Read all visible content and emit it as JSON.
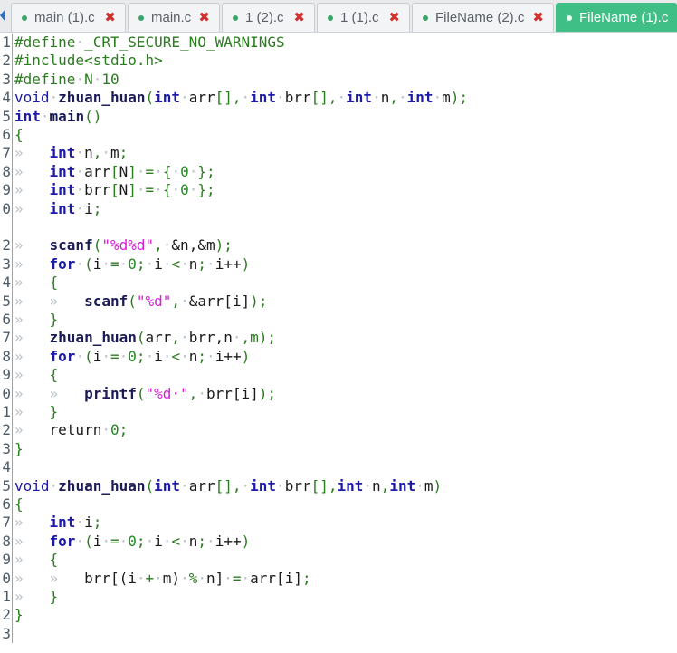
{
  "tabs": [
    {
      "label": "main (1).c",
      "active": false
    },
    {
      "label": "main.c",
      "active": false
    },
    {
      "label": "1 (2).c",
      "active": false
    },
    {
      "label": "1 (1).c",
      "active": false
    },
    {
      "label": "FileName (2).c",
      "active": false
    },
    {
      "label": "FileName (1).c",
      "active": true
    }
  ],
  "tab_close_glyph": "✖",
  "colors": {
    "active_tab": "#3fbf86",
    "close": "#d0312d",
    "keyword": "#1c1aa8",
    "string": "#d61fd6",
    "number": "#228b22"
  },
  "lines": [
    {
      "n": "1",
      "tokens": [
        [
          "pp",
          "#define"
        ],
        [
          "ws",
          "·"
        ],
        [
          "pp",
          "_CRT_SECURE_NO_WARNINGS"
        ]
      ]
    },
    {
      "n": "2",
      "tokens": [
        [
          "pp",
          "#include<stdio.h>"
        ]
      ]
    },
    {
      "n": "3",
      "tokens": [
        [
          "pp",
          "#define"
        ],
        [
          "ws",
          "·"
        ],
        [
          "pp",
          "N"
        ],
        [
          "ws",
          "·"
        ],
        [
          "pp",
          "10"
        ]
      ]
    },
    {
      "n": "4",
      "tokens": [
        [
          "kw2",
          "void"
        ],
        [
          "ws",
          "·"
        ],
        [
          "fn",
          "zhuan_huan"
        ],
        [
          "punc",
          "("
        ],
        [
          "kw",
          "int"
        ],
        [
          "ws",
          "·"
        ],
        [
          "plain",
          "arr"
        ],
        [
          "punc",
          "[],"
        ],
        [
          "ws",
          "·"
        ],
        [
          "kw",
          "int"
        ],
        [
          "ws",
          "·"
        ],
        [
          "plain",
          "brr"
        ],
        [
          "punc",
          "[],"
        ],
        [
          "ws",
          "·"
        ],
        [
          "kw",
          "int"
        ],
        [
          "ws",
          "·"
        ],
        [
          "plain",
          "n"
        ],
        [
          "punc",
          ","
        ],
        [
          "ws",
          "·"
        ],
        [
          "kw",
          "int"
        ],
        [
          "ws",
          "·"
        ],
        [
          "plain",
          "m"
        ],
        [
          "punc",
          ");"
        ]
      ]
    },
    {
      "n": "5",
      "tokens": [
        [
          "kw",
          "int"
        ],
        [
          "ws",
          "·"
        ],
        [
          "fn",
          "main"
        ],
        [
          "punc",
          "()"
        ]
      ]
    },
    {
      "n": "6",
      "tokens": [
        [
          "punc",
          "{"
        ]
      ]
    },
    {
      "n": "7",
      "tokens": [
        [
          "ws",
          "»   "
        ],
        [
          "kw",
          "int"
        ],
        [
          "ws",
          "·"
        ],
        [
          "plain",
          "n"
        ],
        [
          "punc",
          ","
        ],
        [
          "ws",
          "·"
        ],
        [
          "plain",
          "m"
        ],
        [
          "punc",
          ";"
        ]
      ]
    },
    {
      "n": "8",
      "tokens": [
        [
          "ws",
          "»   "
        ],
        [
          "kw",
          "int"
        ],
        [
          "ws",
          "·"
        ],
        [
          "plain",
          "arr"
        ],
        [
          "punc",
          "["
        ],
        [
          "plain",
          "N"
        ],
        [
          "punc",
          "]"
        ],
        [
          "ws",
          "·"
        ],
        [
          "punc",
          "="
        ],
        [
          "ws",
          "·"
        ],
        [
          "punc",
          "{"
        ],
        [
          "ws",
          "·"
        ],
        [
          "num",
          "0"
        ],
        [
          "ws",
          "·"
        ],
        [
          "punc",
          "};"
        ]
      ]
    },
    {
      "n": "9",
      "tokens": [
        [
          "ws",
          "»   "
        ],
        [
          "kw",
          "int"
        ],
        [
          "ws",
          "·"
        ],
        [
          "plain",
          "brr"
        ],
        [
          "punc",
          "["
        ],
        [
          "plain",
          "N"
        ],
        [
          "punc",
          "]"
        ],
        [
          "ws",
          "·"
        ],
        [
          "punc",
          "="
        ],
        [
          "ws",
          "·"
        ],
        [
          "punc",
          "{"
        ],
        [
          "ws",
          "·"
        ],
        [
          "num",
          "0"
        ],
        [
          "ws",
          "·"
        ],
        [
          "punc",
          "};"
        ]
      ]
    },
    {
      "n": "0",
      "tokens": [
        [
          "ws",
          "»   "
        ],
        [
          "kw",
          "int"
        ],
        [
          "ws",
          "·"
        ],
        [
          "plain",
          "i"
        ],
        [
          "punc",
          ";"
        ]
      ]
    },
    {
      "n": "",
      "tokens": []
    },
    {
      "n": "2",
      "tokens": [
        [
          "ws",
          "»   "
        ],
        [
          "fn",
          "scanf"
        ],
        [
          "punc",
          "("
        ],
        [
          "str",
          "\"%d%d\""
        ],
        [
          "punc",
          ","
        ],
        [
          "ws",
          "·"
        ],
        [
          "plain",
          "&n,&m"
        ],
        [
          "punc",
          ");"
        ]
      ]
    },
    {
      "n": "3",
      "tokens": [
        [
          "ws",
          "»   "
        ],
        [
          "kw",
          "for"
        ],
        [
          "ws",
          "·"
        ],
        [
          "punc",
          "("
        ],
        [
          "plain",
          "i"
        ],
        [
          "ws",
          "·"
        ],
        [
          "punc",
          "="
        ],
        [
          "ws",
          "·"
        ],
        [
          "num",
          "0"
        ],
        [
          "punc",
          ";"
        ],
        [
          "ws",
          "·"
        ],
        [
          "plain",
          "i"
        ],
        [
          "ws",
          "·"
        ],
        [
          "punc",
          "<"
        ],
        [
          "ws",
          "·"
        ],
        [
          "plain",
          "n"
        ],
        [
          "punc",
          ";"
        ],
        [
          "ws",
          "·"
        ],
        [
          "plain",
          "i++"
        ],
        [
          "punc",
          ")"
        ]
      ]
    },
    {
      "n": "4",
      "tokens": [
        [
          "ws",
          "»   "
        ],
        [
          "punc",
          "{"
        ]
      ]
    },
    {
      "n": "5",
      "tokens": [
        [
          "ws",
          "»   »   "
        ],
        [
          "fn",
          "scanf"
        ],
        [
          "punc",
          "("
        ],
        [
          "str",
          "\"%d\""
        ],
        [
          "punc",
          ","
        ],
        [
          "ws",
          "·"
        ],
        [
          "plain",
          "&arr[i]"
        ],
        [
          "punc",
          ");"
        ]
      ]
    },
    {
      "n": "6",
      "tokens": [
        [
          "ws",
          "»   "
        ],
        [
          "punc",
          "}"
        ]
      ]
    },
    {
      "n": "7",
      "tokens": [
        [
          "ws",
          "»   "
        ],
        [
          "fn",
          "zhuan_huan"
        ],
        [
          "punc",
          "("
        ],
        [
          "plain",
          "arr"
        ],
        [
          "punc",
          ","
        ],
        [
          "ws",
          "·"
        ],
        [
          "plain",
          "brr,n"
        ],
        [
          "ws",
          "·"
        ],
        [
          "punc",
          ",m);"
        ]
      ]
    },
    {
      "n": "8",
      "tokens": [
        [
          "ws",
          "»   "
        ],
        [
          "kw",
          "for"
        ],
        [
          "ws",
          "·"
        ],
        [
          "punc",
          "("
        ],
        [
          "plain",
          "i"
        ],
        [
          "ws",
          "·"
        ],
        [
          "punc",
          "="
        ],
        [
          "ws",
          "·"
        ],
        [
          "num",
          "0"
        ],
        [
          "punc",
          ";"
        ],
        [
          "ws",
          "·"
        ],
        [
          "plain",
          "i"
        ],
        [
          "ws",
          "·"
        ],
        [
          "punc",
          "<"
        ],
        [
          "ws",
          "·"
        ],
        [
          "plain",
          "n"
        ],
        [
          "punc",
          ";"
        ],
        [
          "ws",
          "·"
        ],
        [
          "plain",
          "i++"
        ],
        [
          "punc",
          ")"
        ]
      ]
    },
    {
      "n": "9",
      "tokens": [
        [
          "ws",
          "»   "
        ],
        [
          "punc",
          "{"
        ]
      ]
    },
    {
      "n": "0",
      "tokens": [
        [
          "ws",
          "»   »   "
        ],
        [
          "fn",
          "printf"
        ],
        [
          "punc",
          "("
        ],
        [
          "str",
          "\"%d·\""
        ],
        [
          "punc",
          ","
        ],
        [
          "ws",
          "·"
        ],
        [
          "plain",
          "brr[i]"
        ],
        [
          "punc",
          ");"
        ]
      ]
    },
    {
      "n": "1",
      "tokens": [
        [
          "ws",
          "»   "
        ],
        [
          "punc",
          "}"
        ]
      ]
    },
    {
      "n": "2",
      "tokens": [
        [
          "ws",
          "»   "
        ],
        [
          "ret",
          "return"
        ],
        [
          "ws",
          "·"
        ],
        [
          "num",
          "0"
        ],
        [
          "punc",
          ";"
        ]
      ]
    },
    {
      "n": "3",
      "tokens": [
        [
          "punc",
          "}"
        ]
      ]
    },
    {
      "n": "4",
      "tokens": []
    },
    {
      "n": "5",
      "tokens": [
        [
          "kw2",
          "void"
        ],
        [
          "ws",
          "·"
        ],
        [
          "fn",
          "zhuan_huan"
        ],
        [
          "punc",
          "("
        ],
        [
          "kw",
          "int"
        ],
        [
          "ws",
          "·"
        ],
        [
          "plain",
          "arr"
        ],
        [
          "punc",
          "[],"
        ],
        [
          "ws",
          "·"
        ],
        [
          "kw",
          "int"
        ],
        [
          "ws",
          "·"
        ],
        [
          "plain",
          "brr"
        ],
        [
          "punc",
          "[],"
        ],
        [
          "kw",
          "int"
        ],
        [
          "ws",
          "·"
        ],
        [
          "plain",
          "n"
        ],
        [
          "punc",
          ","
        ],
        [
          "kw",
          "int"
        ],
        [
          "ws",
          "·"
        ],
        [
          "plain",
          "m"
        ],
        [
          "punc",
          ")"
        ]
      ]
    },
    {
      "n": "6",
      "tokens": [
        [
          "punc",
          "{"
        ]
      ]
    },
    {
      "n": "7",
      "tokens": [
        [
          "ws",
          "»   "
        ],
        [
          "kw",
          "int"
        ],
        [
          "ws",
          "·"
        ],
        [
          "plain",
          "i"
        ],
        [
          "punc",
          ";"
        ]
      ]
    },
    {
      "n": "8",
      "tokens": [
        [
          "ws",
          "»   "
        ],
        [
          "kw",
          "for"
        ],
        [
          "ws",
          "·"
        ],
        [
          "punc",
          "("
        ],
        [
          "plain",
          "i"
        ],
        [
          "ws",
          "·"
        ],
        [
          "punc",
          "="
        ],
        [
          "ws",
          "·"
        ],
        [
          "num",
          "0"
        ],
        [
          "punc",
          ";"
        ],
        [
          "ws",
          "·"
        ],
        [
          "plain",
          "i"
        ],
        [
          "ws",
          "·"
        ],
        [
          "punc",
          "<"
        ],
        [
          "ws",
          "·"
        ],
        [
          "plain",
          "n"
        ],
        [
          "punc",
          ";"
        ],
        [
          "ws",
          "·"
        ],
        [
          "plain",
          "i++"
        ],
        [
          "punc",
          ")"
        ]
      ]
    },
    {
      "n": "9",
      "tokens": [
        [
          "ws",
          "»   "
        ],
        [
          "punc",
          "{"
        ]
      ]
    },
    {
      "n": "0",
      "tokens": [
        [
          "ws",
          "»   »   "
        ],
        [
          "plain",
          "brr[(i"
        ],
        [
          "ws",
          "·"
        ],
        [
          "punc",
          "+"
        ],
        [
          "ws",
          "·"
        ],
        [
          "plain",
          "m)"
        ],
        [
          "ws",
          "·"
        ],
        [
          "punc",
          "%"
        ],
        [
          "ws",
          "·"
        ],
        [
          "plain",
          "n]"
        ],
        [
          "ws",
          "·"
        ],
        [
          "punc",
          "="
        ],
        [
          "ws",
          "·"
        ],
        [
          "plain",
          "arr[i]"
        ],
        [
          "punc",
          ";"
        ]
      ]
    },
    {
      "n": "1",
      "tokens": [
        [
          "ws",
          "»   "
        ],
        [
          "punc",
          "}"
        ]
      ]
    },
    {
      "n": "2",
      "tokens": [
        [
          "punc",
          "}"
        ]
      ]
    },
    {
      "n": "3",
      "tokens": []
    }
  ]
}
